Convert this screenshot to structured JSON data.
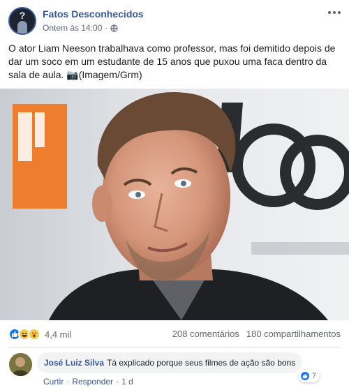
{
  "post": {
    "page_name": "Fatos Desconhecidos",
    "timestamp": "Ontem às 14:00",
    "meta_separator": "·",
    "privacy_icon": "globe-icon",
    "text": "O ator Liam Neeson trabalhava como professor, mas foi demitido depois de dar um soco em um estudante de 15 anos que puxou uma faca dentro da sala de aula. 📷(Imagem/Grm)"
  },
  "stats": {
    "reaction_icons": [
      "like-icon",
      "haha-icon",
      "wow-icon"
    ],
    "reaction_count": "4,4 mil",
    "comments": "208 comentários",
    "shares": "180 compartilhamentos"
  },
  "comment": {
    "author": "José Luiz Silva",
    "text": "Tá explicado porque seus filmes de ação são bons",
    "actions": {
      "like": "Curtir",
      "sep1": "·",
      "reply": "Responder",
      "sep2": "·",
      "time": "1 d"
    },
    "likes": "7"
  },
  "colors": {
    "link_blue": "#385898",
    "like_blue": "#1877f2",
    "emoji_yellow": "#f7c94b",
    "backdrop_orange": "#ef7d2e"
  }
}
